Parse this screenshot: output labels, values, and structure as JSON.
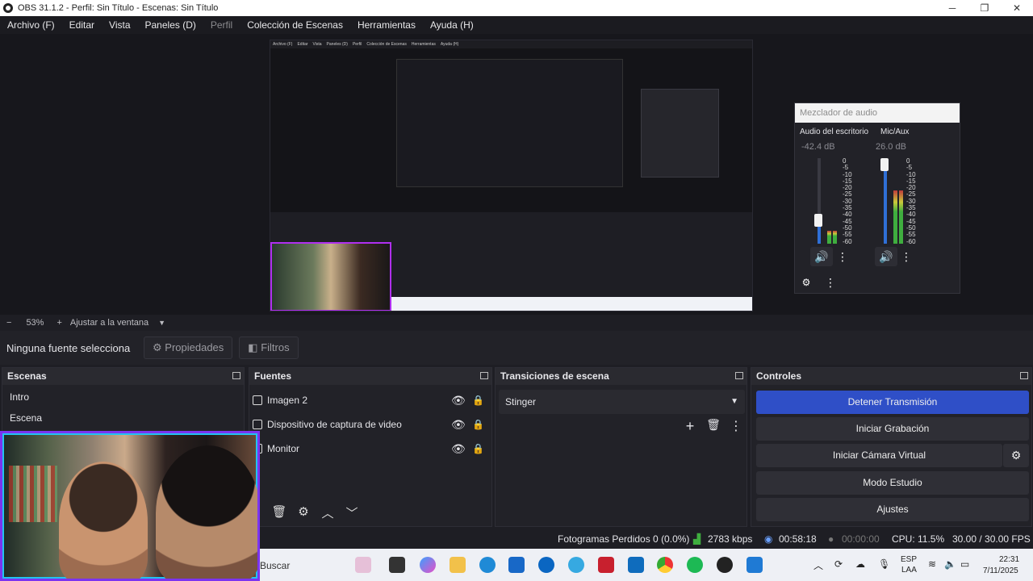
{
  "window": {
    "title": "OBS 31.1.2 - Perfil: Sin Título - Escenas: Sin Título"
  },
  "menu": [
    "Archivo (F)",
    "Editar",
    "Vista",
    "Paneles (D)",
    "Perfil",
    "Colección de Escenas",
    "Herramientas",
    "Ayuda (H)"
  ],
  "mixer": {
    "title": "Mezclador de audio",
    "channels": [
      {
        "name": "Audio del escritorio",
        "db": "-42.4 dB",
        "level": 0.15,
        "fader": 0.27
      },
      {
        "name": "Mic/Aux",
        "db": "26.0 dB",
        "level": 0.62,
        "fader": 0.95
      }
    ],
    "scale": [
      "0",
      "-5",
      "-10",
      "-15",
      "-20",
      "-25",
      "-30",
      "-35",
      "-40",
      "-45",
      "-50",
      "-55",
      "-60"
    ]
  },
  "zoom": {
    "minus": "−",
    "value": "53%",
    "plus": "+",
    "fit": "Ajustar a la ventana"
  },
  "source_bar": {
    "no_selection": "Ninguna fuente selecciona",
    "properties": "Propiedades",
    "filters": "Filtros"
  },
  "scenes": {
    "title": "Escenas",
    "items": [
      "Intro",
      "Escena"
    ]
  },
  "sources": {
    "title": "Fuentes",
    "items": [
      {
        "name": "Imagen 2",
        "icon": "image-icon"
      },
      {
        "name": "Dispositivo de captura de video",
        "icon": "camera-icon"
      },
      {
        "name": "Monitor",
        "icon": "monitor-icon"
      }
    ]
  },
  "transitions": {
    "title": "Transiciones de escena",
    "selected": "Stinger"
  },
  "controls": {
    "title": "Controles",
    "stop_stream": "Detener Transmisión",
    "start_recording": "Iniciar Grabación",
    "virtual_cam": "Iniciar Cámara Virtual",
    "studio_mode": "Modo Estudio",
    "settings": "Ajustes"
  },
  "status": {
    "dropped": "Fotogramas Perdidos 0 (0.0%)",
    "bitrate": "2783 kbps",
    "stream_time": "00:58:18",
    "rec_time": "00:00:00",
    "cpu": "CPU: 11.5%",
    "fps": "30.00 / 30.00 FPS"
  },
  "taskbar": {
    "search": "Buscar",
    "lang": "ESP",
    "lang2": "LAA",
    "time": "22:31",
    "date": "7/11/2025"
  },
  "colors": {
    "accent": "#2f4fc7",
    "webcam_border": "#7b34f0"
  }
}
